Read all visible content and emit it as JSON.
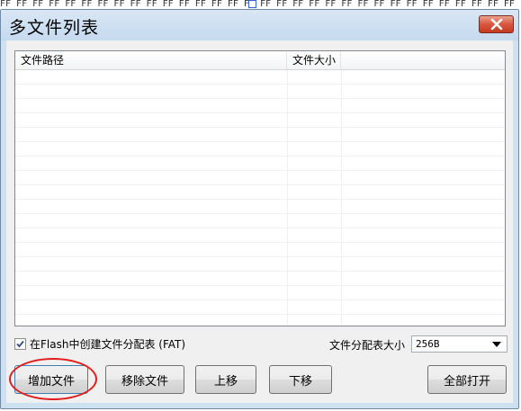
{
  "background": {
    "hex_strip": "FF FF FF FF FF FF FF FF FF FF FF FF FF FF FF FF FF FF FF FF FF FF FF FF FF FF FF FF FF FF FF FF FF FF FF FF FF FF FF FF FF FF FF FF FF FF FF FF"
  },
  "window": {
    "title": "多文件列表",
    "close_icon": "close-icon"
  },
  "file_list": {
    "columns": [
      "文件路径",
      "文件大小",
      ""
    ],
    "rows": []
  },
  "options": {
    "create_fat_label": "在Flash中创建文件分配表 (FAT)",
    "create_fat_checked": true,
    "fat_size_label": "文件分配表大小",
    "fat_size_value": "256B"
  },
  "buttons": {
    "add_file": "增加文件",
    "remove_file": "移除文件",
    "move_up": "上移",
    "move_down": "下移",
    "open_all": "全部打开"
  },
  "colors": {
    "highlight_ring": "#e01c1c",
    "close_button": "#c43b1f",
    "window_frame": "#cfe0f1"
  }
}
